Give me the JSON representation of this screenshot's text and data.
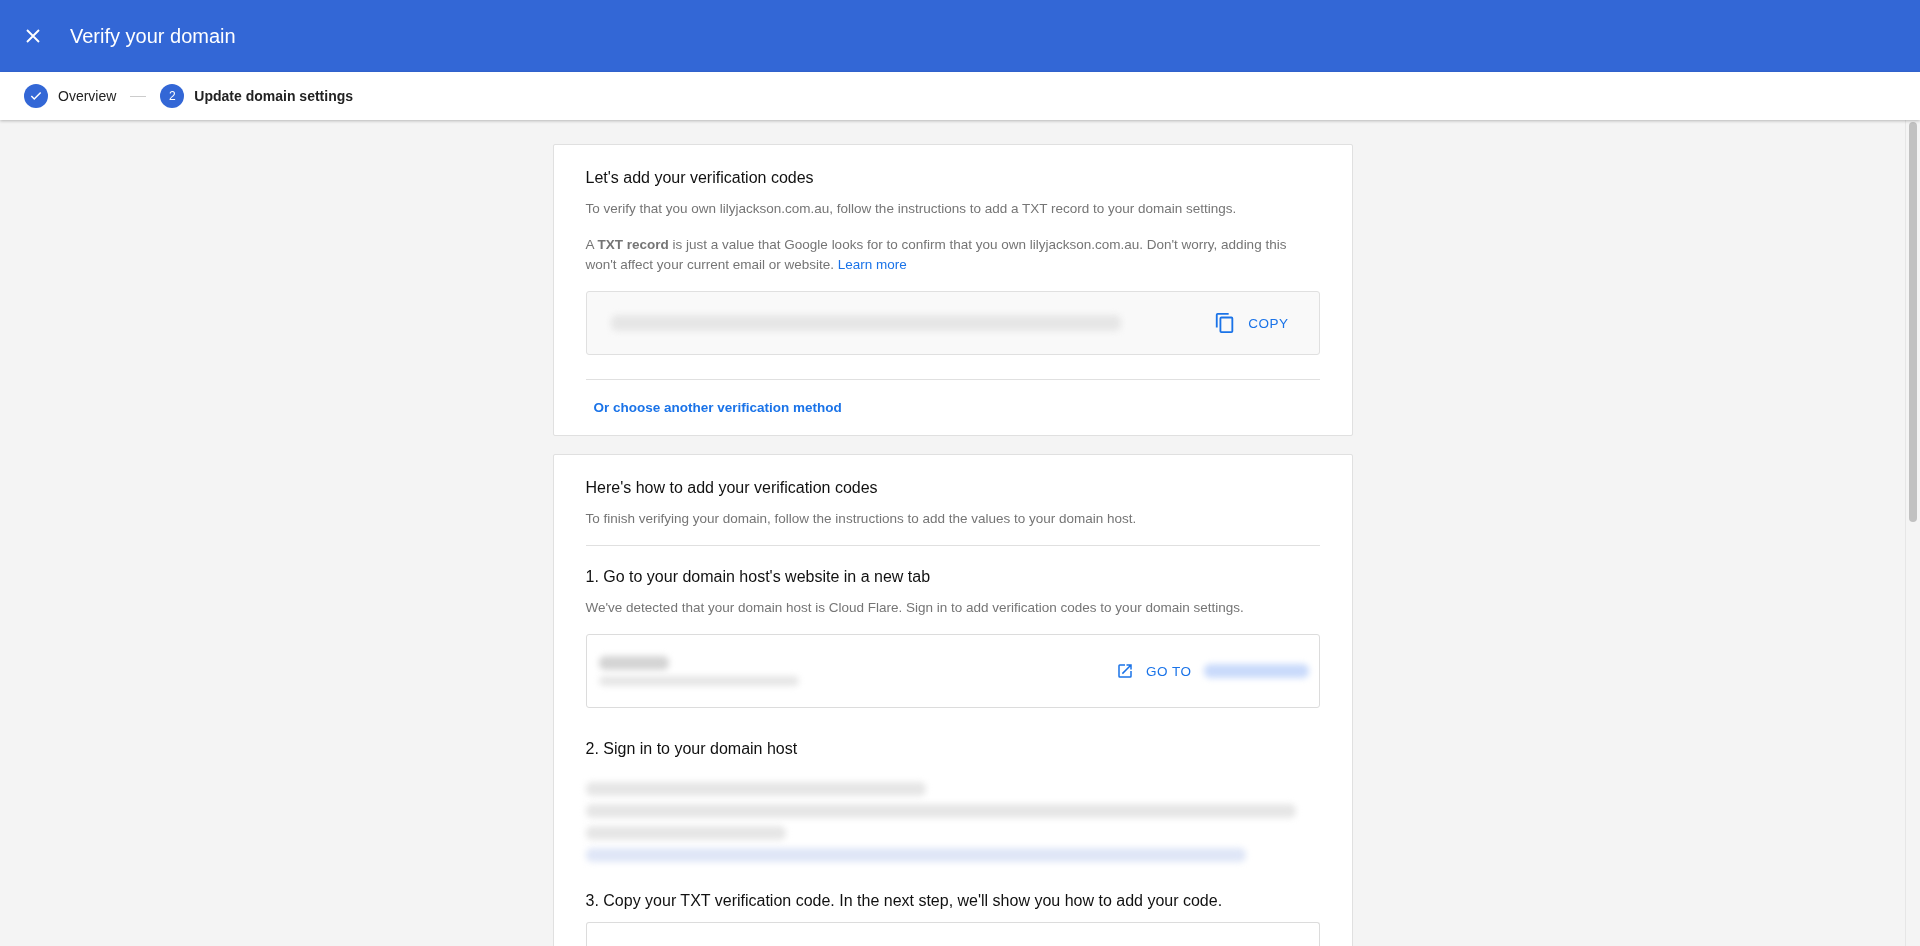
{
  "header": {
    "title": "Verify your domain"
  },
  "stepper": [
    {
      "label": "Overview",
      "completed": true,
      "selected": false
    },
    {
      "label": "Update domain settings",
      "number": "2",
      "completed": false,
      "selected": true
    }
  ],
  "codes_card": {
    "title": "Let's add your verification codes",
    "intro": "To verify that you own lilyjackson.com.au, follow the instructions to add a TXT record to your domain settings.",
    "explanation": "A **TXT record** is just a value that Google looks for to confirm that you own lilyjackson.com.au. Don't worry, adding this won't affect your current email or website.",
    "learn_more": "Learn more",
    "copy_button": "COPY",
    "alternative_link": "Or choose another verification method"
  },
  "howto_card": {
    "title": "Here's how to add your verification codes",
    "intro": "To finish verifying your domain, follow the instructions to add the values to your domain host.",
    "steps": [
      {
        "title": "1. Go to your domain host's website in a new tab",
        "kind": "host",
        "description": "We've detected that your domain host is Cloud Flare. Sign in to add verification codes to your domain settings.",
        "go_button": "GO TO"
      },
      {
        "title": "2. Sign in to your domain host",
        "kind": "redacted"
      },
      {
        "title": "3. Copy your TXT verification code. In the next step, we'll show you how to add your code.",
        "kind": "code"
      }
    ]
  }
}
